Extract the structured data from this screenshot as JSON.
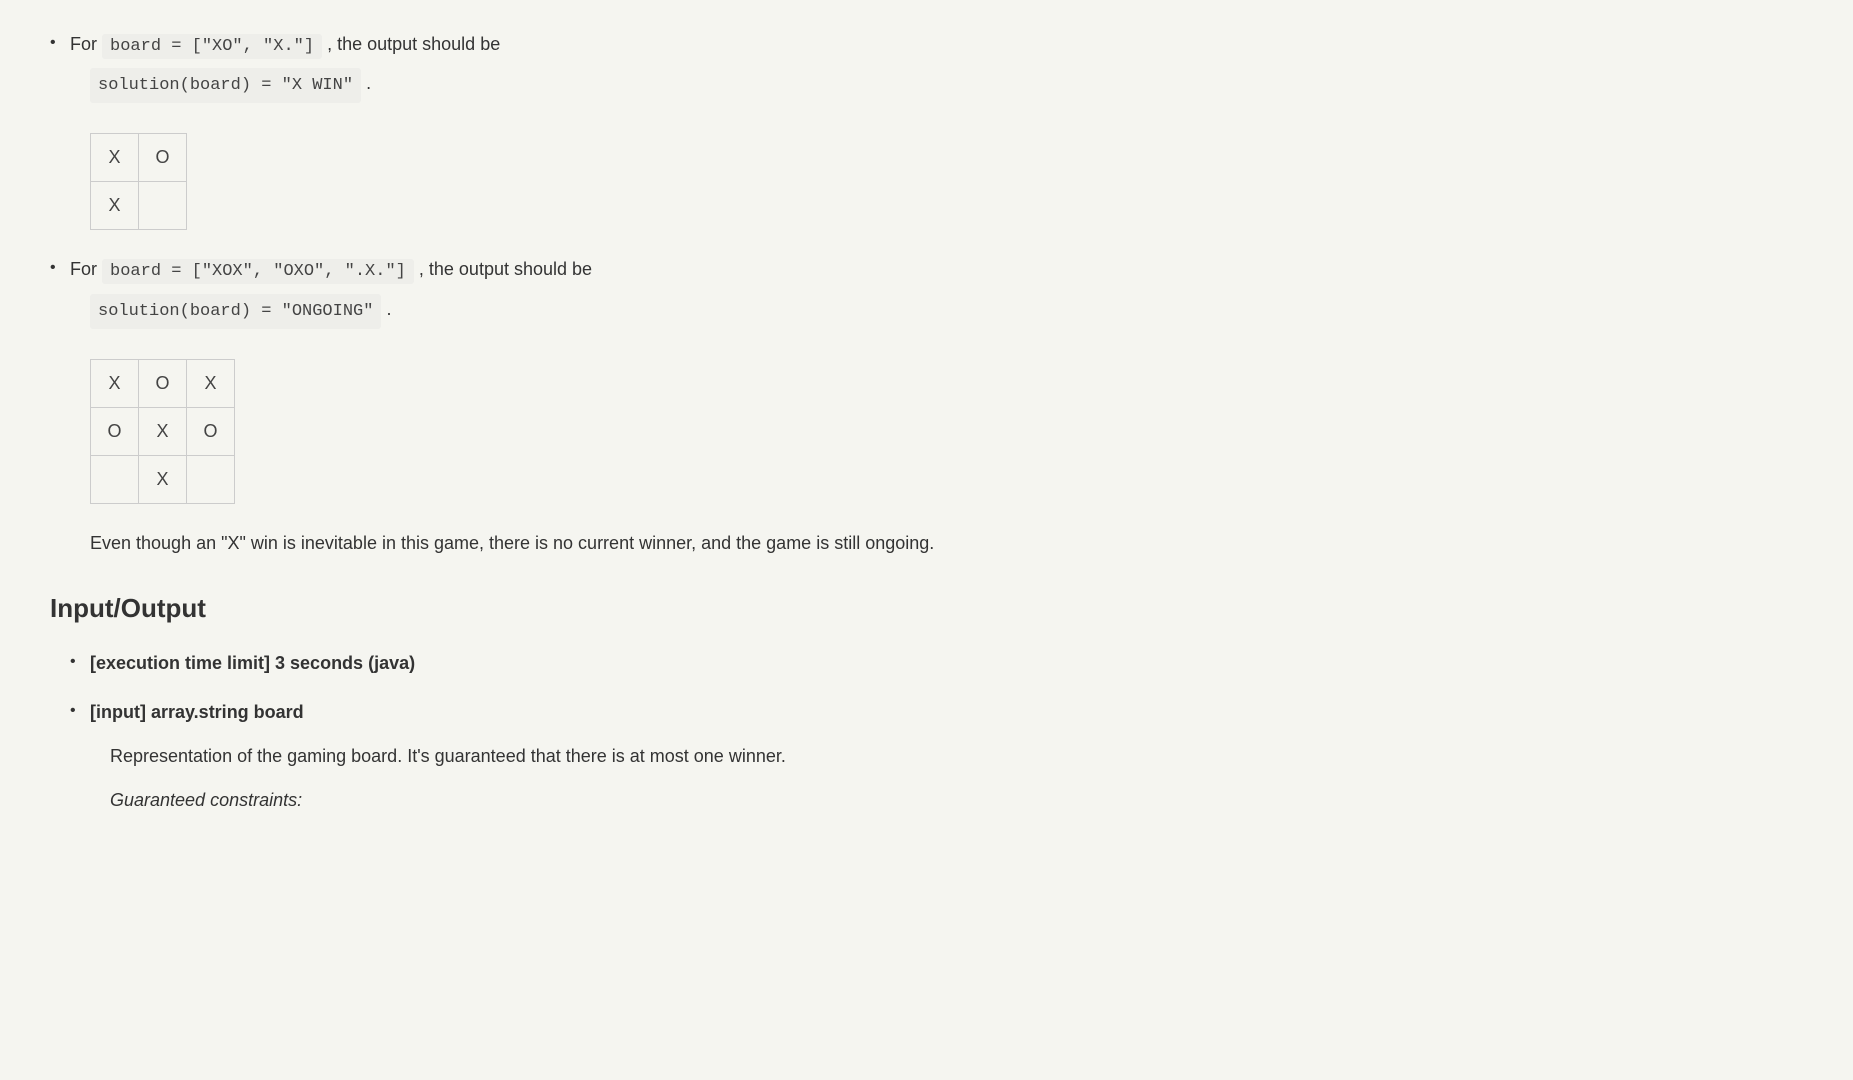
{
  "example1": {
    "for_text": "For ",
    "board_code": "board = [\"XO\", \"X.\"]",
    "output_text": " , the output should be",
    "solution_code": "solution(board) = \"X WIN\"",
    "period": " .",
    "grid": [
      [
        "X",
        "O"
      ],
      [
        "X",
        ""
      ]
    ]
  },
  "example2": {
    "for_text": "For ",
    "board_code": "board = [\"XOX\", \"OXO\", \".X.\"]",
    "output_text": " , the output should be",
    "solution_code": "solution(board) = \"ONGOING\"",
    "period": " .",
    "grid": [
      [
        "X",
        "O",
        "X"
      ],
      [
        "O",
        "X",
        "O"
      ],
      [
        "",
        "X",
        ""
      ]
    ],
    "explanation": "Even though an \"X\" win is inevitable in this game, there is no current winner, and the game is still ongoing."
  },
  "io_heading": "Input/Output",
  "io_items": {
    "time_limit": "[execution time limit] 3 seconds (java)",
    "input_label": "[input] array.string board",
    "input_desc": "Representation of the gaming board. It's guaranteed that there is at most one winner.",
    "constraints_label": "Guaranteed constraints:"
  }
}
